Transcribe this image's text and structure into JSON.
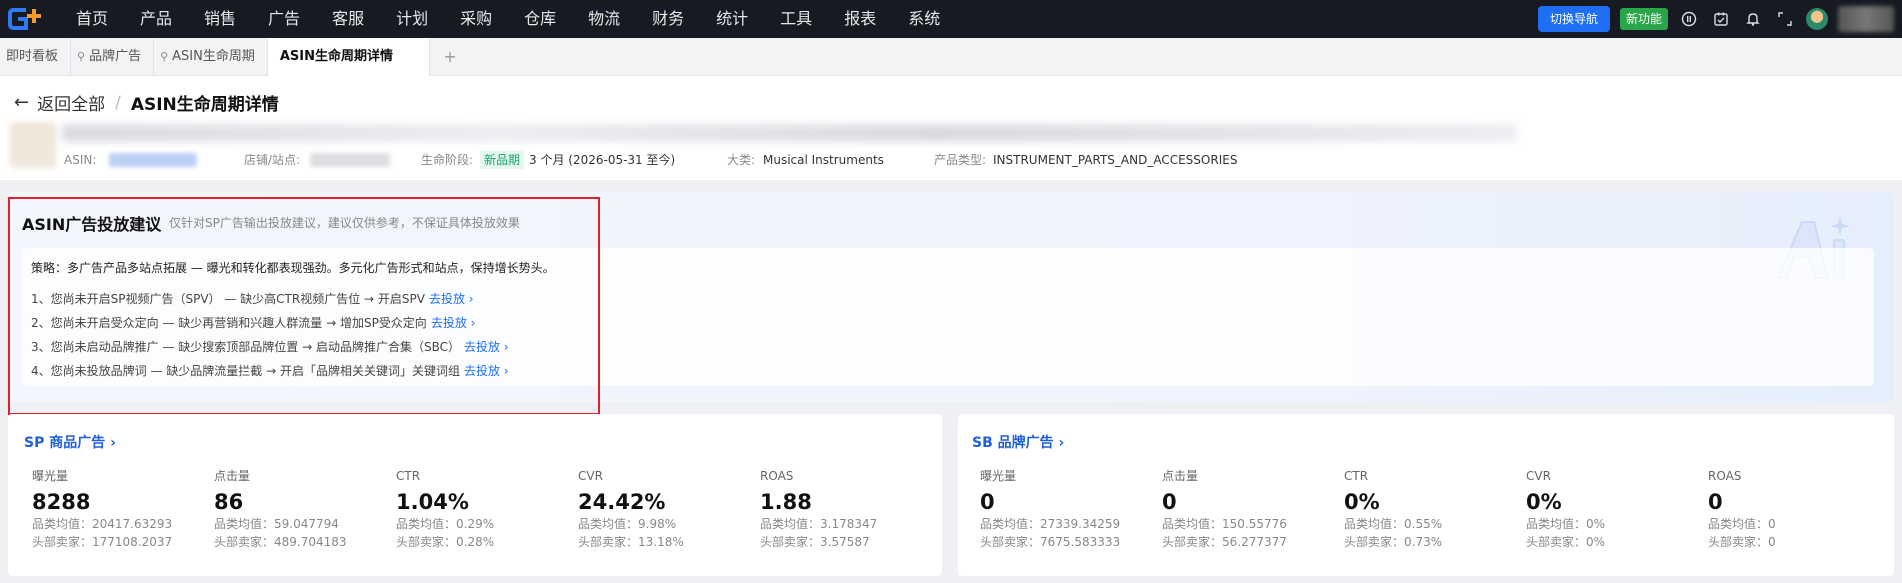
{
  "nav": {
    "items": [
      "首页",
      "产品",
      "销售",
      "广告",
      "客服",
      "计划",
      "采购",
      "仓库",
      "物流",
      "财务",
      "统计",
      "工具",
      "报表",
      "系统"
    ],
    "switch_nav": "切换导航",
    "new_feature": "新功能"
  },
  "tabs": {
    "items": [
      {
        "label": "即时看板"
      },
      {
        "label": "品牌广告"
      },
      {
        "label": "ASIN生命周期"
      },
      {
        "label": "ASIN生命周期详情"
      }
    ],
    "add": "+"
  },
  "header": {
    "back_label": "返回全部",
    "separator": "/",
    "title": "ASIN生命周期详情",
    "asin_label": "ASIN:",
    "store_label": "店铺/站点:",
    "stage_label": "生命阶段:",
    "stage_badge": "新品期",
    "stage_value": "3 个月 (2026-05-31 至今)",
    "category_label": "大类:",
    "category_value": "Musical Instruments",
    "product_type_label": "产品类型:",
    "product_type_value": "INSTRUMENT_PARTS_AND_ACCESSORIES"
  },
  "suggestion": {
    "title": "ASIN广告投放建议",
    "subtitle": "仅针对SP广告输出投放建议，建议仅供参考，不保证具体投放效果",
    "strategy": "策略：多广告产品多站点拓展 — 曝光和转化都表现强劲。多元化广告形式和站点，保持增长势头。",
    "items": [
      {
        "text": "1、您尚未开启SP视频广告（SPV） — 缺少高CTR视频广告位 → 开启SPV",
        "link": "去投放 ›"
      },
      {
        "text": "2、您尚未开启受众定向 — 缺少再营销和兴趣人群流量 → 增加SP受众定向",
        "link": "去投放 ›"
      },
      {
        "text": "3、您尚未启动品牌推广 — 缺少搜索顶部品牌位置 → 启动品牌推广合集（SBC）",
        "link": "去投放 ›"
      },
      {
        "text": "4、您尚未投放品牌词 — 缺少品牌流量拦截 → 开启「品牌相关关键词」关键词组",
        "link": "去投放 ›"
      }
    ]
  },
  "sp_card": {
    "title": "SP 商品广告 ›",
    "metrics": [
      {
        "label": "曝光量",
        "value": "8288",
        "avg": "品类均值：20417.63293",
        "top": "头部卖家：177108.2037"
      },
      {
        "label": "点击量",
        "value": "86",
        "avg": "品类均值：59.047794",
        "top": "头部卖家：489.704183"
      },
      {
        "label": "CTR",
        "value": "1.04%",
        "avg": "品类均值：0.29%",
        "top": "头部卖家：0.28%"
      },
      {
        "label": "CVR",
        "value": "24.42%",
        "avg": "品类均值：9.98%",
        "top": "头部卖家：13.18%"
      },
      {
        "label": "ROAS",
        "value": "1.88",
        "avg": "品类均值：3.178347",
        "top": "头部卖家：3.57587"
      }
    ]
  },
  "sb_card": {
    "title": "SB 品牌广告 ›",
    "metrics": [
      {
        "label": "曝光量",
        "value": "0",
        "avg": "品类均值：27339.34259",
        "top": "头部卖家：7675.583333"
      },
      {
        "label": "点击量",
        "value": "0",
        "avg": "品类均值：150.55776",
        "top": "头部卖家：56.277377"
      },
      {
        "label": "CTR",
        "value": "0%",
        "avg": "品类均值：0.55%",
        "top": "头部卖家：0.73%"
      },
      {
        "label": "CVR",
        "value": "0%",
        "avg": "品类均值：0%",
        "top": "头部卖家：0%"
      },
      {
        "label": "ROAS",
        "value": "0",
        "avg": "品类均值：0",
        "top": "头部卖家：0"
      }
    ]
  },
  "colors": {
    "accent": "#1f6ff5",
    "topbar": "#171a22",
    "highlight": "#e0202a",
    "success": "#2aa64a"
  },
  "icons": [
    "logo-icon",
    "help-icon",
    "calendar-check-icon",
    "bell-icon",
    "fullscreen-icon",
    "avatar-icon",
    "back-arrow-icon",
    "pin-icon",
    "ai-watermark-icon"
  ]
}
